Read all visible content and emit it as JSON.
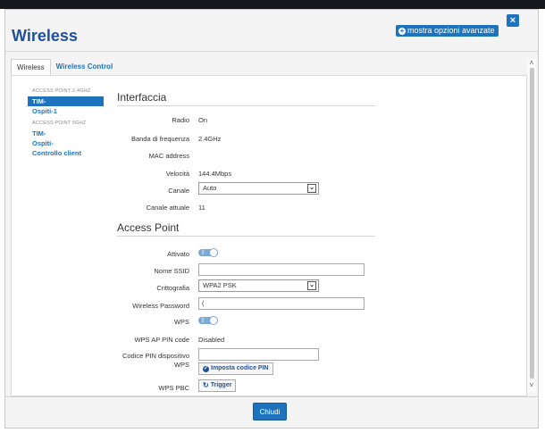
{
  "window": {
    "title": "Wireless",
    "close_label": "×",
    "advanced_button": "mostra opzioni avanzate"
  },
  "tabs": [
    {
      "label": "Wireless",
      "active": true
    },
    {
      "label": "Wireless Control",
      "active": false
    }
  ],
  "sidebar": {
    "group_24": "ACCESS POINT 2.4GHZ",
    "items_24": [
      "TIM-",
      "Ospiti-1"
    ],
    "group_5": "ACCESS POINT 5GHZ",
    "items_5": [
      "TIM-",
      "Ospiti-"
    ],
    "extra_item": "Controllo client"
  },
  "interfaccia": {
    "title": "Interfaccia",
    "radio_label": "Radio",
    "radio_value": "On",
    "banda_label": "Banda di frequenza",
    "banda_value": "2.4GHz",
    "mac_label": "MAC address",
    "mac_value": "",
    "velocita_label": "Velocità",
    "velocita_value": "144.4Mbps",
    "canale_label": "Canale",
    "canale_value": "Auto",
    "canale_attuale_label": "Canale attuale",
    "canale_attuale_value": "11"
  },
  "access_point": {
    "title": "Access Point",
    "attivato_label": "Attivato",
    "ssid_label": "Nome SSID",
    "ssid_value": "",
    "crittografia_label": "Crittografia",
    "crittografia_value": "WPA2 PSK",
    "password_label": "Wireless Password",
    "password_value": "(",
    "wps_label": "WPS",
    "wps_pin_label": "WPS AP PIN code",
    "wps_pin_value": "Disabled",
    "pin_dispositivo_label": "Codice PIN dispositivo",
    "pin_dispositivo_label2": "WPS",
    "pin_dispositivo_value": "",
    "imposta_pin_button": "Imposta codice PIN",
    "wps_pbc_label": "WPS PBC",
    "trigger_button": "Trigger"
  },
  "footer": {
    "chiudi_button": "Chiudi"
  },
  "colors": {
    "accent": "#1e73be",
    "title": "#1e4f9c"
  }
}
